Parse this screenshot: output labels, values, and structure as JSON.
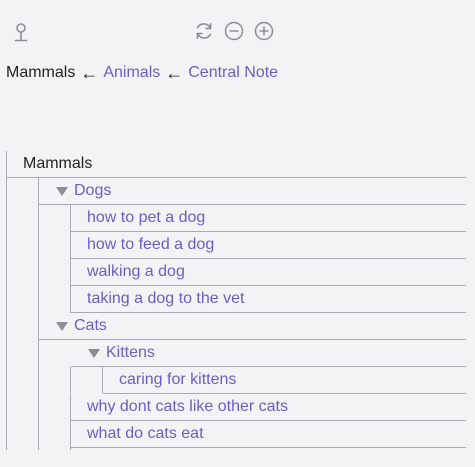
{
  "toolbar": {
    "left_icon": "pin-icon",
    "buttons": [
      {
        "icon": "refresh-icon"
      },
      {
        "icon": "zoom-out-icon"
      },
      {
        "icon": "zoom-in-icon"
      }
    ]
  },
  "breadcrumb": {
    "current": "Mammals",
    "separator": "←",
    "links": [
      "Animals",
      "Central Note"
    ]
  },
  "tree": {
    "root": "Mammals",
    "dogs": {
      "label": "Dogs",
      "children": [
        "how to pet a dog",
        "how to feed a dog",
        "walking a dog",
        "taking a dog to the vet"
      ]
    },
    "cats": {
      "label": "Cats",
      "kittens": {
        "label": "Kittens",
        "children": [
          "caring for kittens"
        ]
      },
      "children": [
        "why dont cats like other cats",
        "what do cats eat"
      ]
    }
  },
  "colors": {
    "link": "#6a5fc1",
    "text": "#222222",
    "line": "#a8abb0",
    "icon": "#8b8e93",
    "background": "#f2f3f5"
  }
}
